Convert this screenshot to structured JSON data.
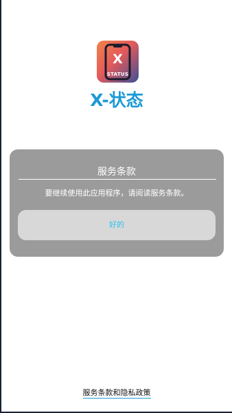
{
  "app": {
    "name": "X-状态",
    "icon": {
      "name": "x-status-app-icon",
      "letter": "X",
      "word": "STATUS"
    }
  },
  "dialog": {
    "title": "服务条款",
    "message": "要继续使用此应用程序，请阅读服务条款。",
    "ok_label": "好的"
  },
  "footer": {
    "policy_link": "服务条款和隐私政策"
  },
  "colors": {
    "brand_blue": "#1d9ad6",
    "dialog_bg": "#9b9b9b",
    "button_bg": "#d8d8d8",
    "button_text": "#2ec4ee"
  }
}
